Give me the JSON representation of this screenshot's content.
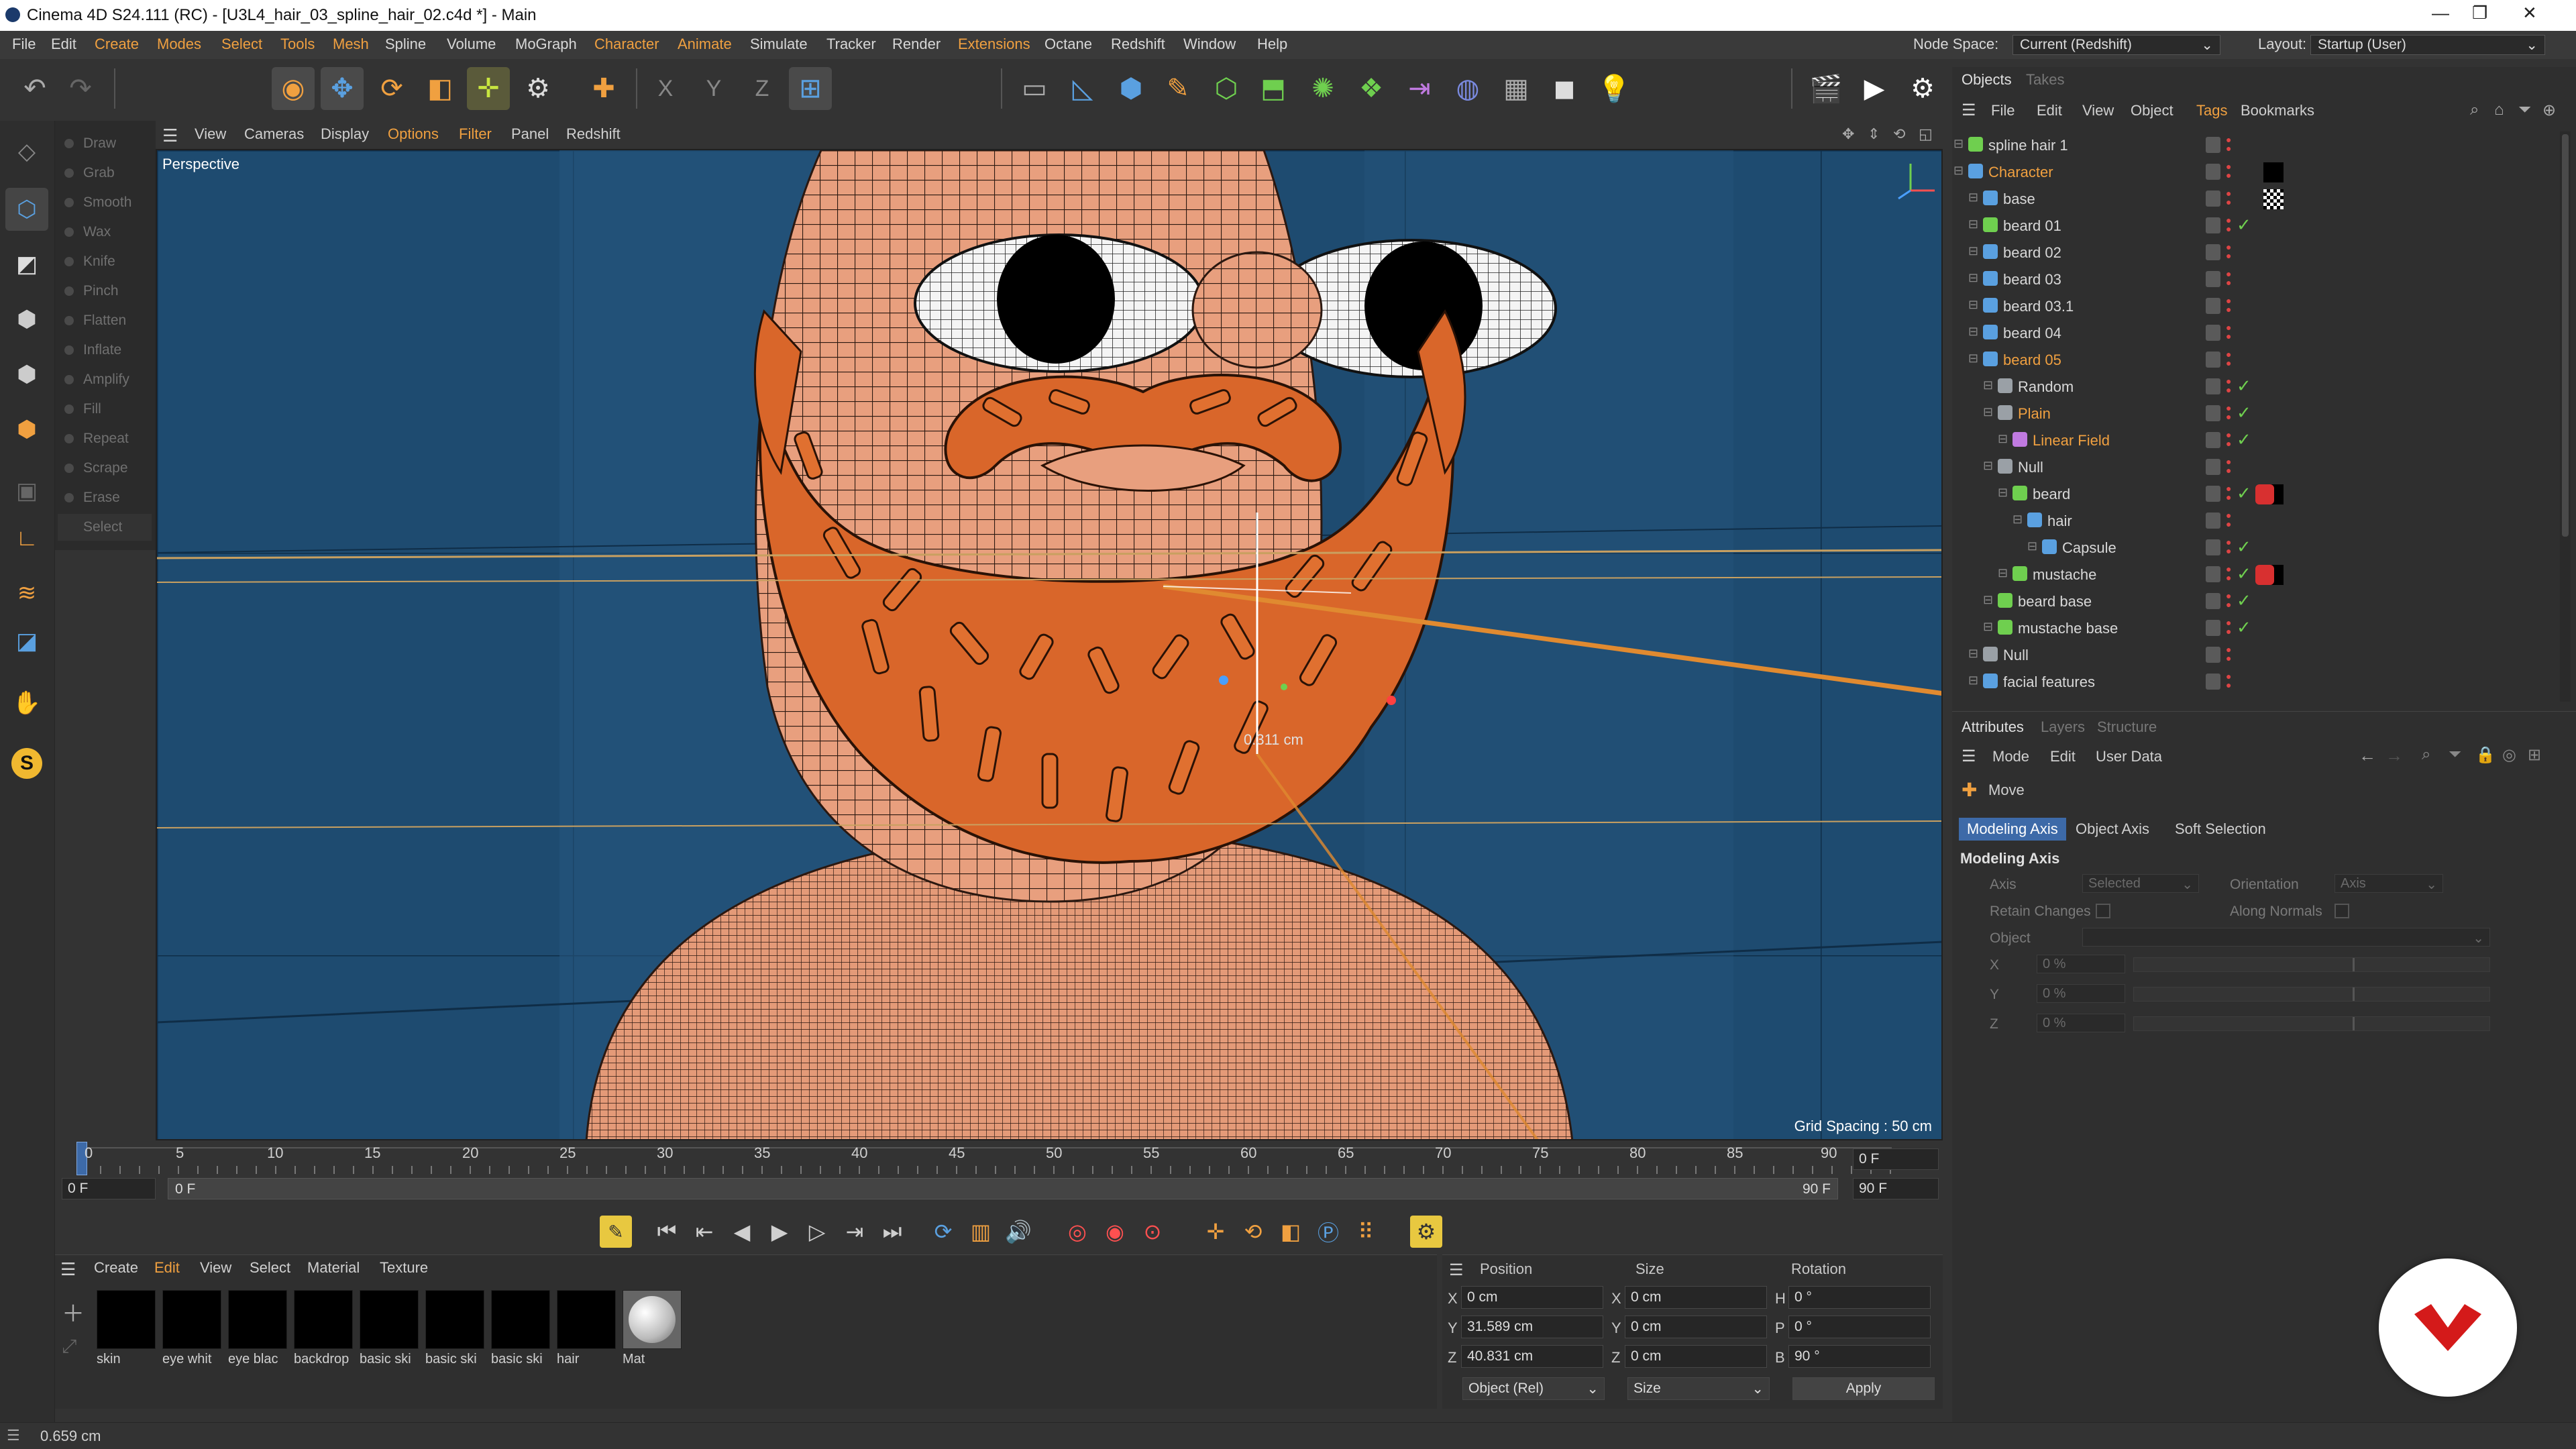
{
  "window": {
    "title": "Cinema 4D S24.111 (RC) - [U3L4_hair_03_spline_hair_02.c4d *] - Main",
    "minimize": "—",
    "maximize": "❐",
    "close": "✕"
  },
  "menu": {
    "items": [
      "File",
      "Edit",
      "Create",
      "Modes",
      "Select",
      "Tools",
      "Mesh",
      "Spline",
      "Volume",
      "MoGraph",
      "Character",
      "Animate",
      "Simulate",
      "Tracker",
      "Render",
      "Extensions",
      "Octane",
      "Redshift",
      "Window",
      "Help"
    ],
    "highlighted": [
      "Create",
      "Modes",
      "Select",
      "Tools",
      "Mesh",
      "Character",
      "Animate",
      "Extensions"
    ],
    "node_space_label": "Node Space:",
    "node_space_value": "Current (Redshift)",
    "layout_label": "Layout:",
    "layout_value": "Startup (User)"
  },
  "toolbar": {
    "axis_x": "X",
    "axis_y": "Y",
    "axis_z": "Z"
  },
  "sculpt": {
    "items": [
      "Draw",
      "Grab",
      "Smooth",
      "Wax",
      "Knife",
      "Pinch",
      "Flatten",
      "Inflate",
      "Amplify",
      "Fill",
      "Repeat",
      "Scrape",
      "Erase",
      "Select"
    ]
  },
  "viewport": {
    "menu": [
      "View",
      "Cameras",
      "Display",
      "Options",
      "Filter",
      "Panel",
      "Redshift"
    ],
    "menu_highlighted": [
      "Options",
      "Filter"
    ],
    "camera": "Perspective",
    "grid_spacing": "Grid Spacing : 50 cm",
    "measure": "0.311 cm"
  },
  "timeline": {
    "ticks": [
      "0",
      "5",
      "10",
      "15",
      "20",
      "25",
      "30",
      "35",
      "40",
      "45",
      "50",
      "55",
      "60",
      "65",
      "70",
      "75",
      "80",
      "85",
      "90"
    ],
    "current_frame": "0 F",
    "start": "0 F",
    "range_start": "0 F",
    "range_end": "90 F",
    "end": "90 F",
    "max": "90 F"
  },
  "materials": {
    "menu": [
      "Create",
      "Edit",
      "View",
      "Select",
      "Material",
      "Texture"
    ],
    "menu_highlighted": [
      "Edit"
    ],
    "items": [
      "skin",
      "eye whit",
      "eye blac",
      "backdrop",
      "basic ski",
      "basic ski",
      "basic ski",
      "hair",
      "Mat"
    ]
  },
  "coords": {
    "headers": [
      "Position",
      "Size",
      "Rotation"
    ],
    "rows": [
      {
        "axis": "X",
        "pos": "0 cm",
        "size_axis": "X",
        "size": "0 cm",
        "rot_axis": "H",
        "rot": "0 °"
      },
      {
        "axis": "Y",
        "pos": "31.589 cm",
        "size_axis": "Y",
        "size": "0 cm",
        "rot_axis": "P",
        "rot": "0 °"
      },
      {
        "axis": "Z",
        "pos": "40.831 cm",
        "size_axis": "Z",
        "size": "0 cm",
        "rot_axis": "B",
        "rot": "90 °"
      }
    ],
    "mode": "Object (Rel)",
    "size_mode": "Size",
    "apply": "Apply"
  },
  "status": {
    "text": "0.659 cm"
  },
  "objects": {
    "tabs": [
      "Objects",
      "Takes"
    ],
    "menu": [
      "File",
      "Edit",
      "View",
      "Object",
      "Tags",
      "Bookmarks"
    ],
    "menu_highlighted": [
      "Tags"
    ],
    "rows": [
      {
        "name": "spline hair 1",
        "indent": 0,
        "orange": false,
        "icon": "#6fcf4f",
        "check": false
      },
      {
        "name": "Character",
        "indent": 0,
        "orange": true,
        "icon": "#5aa0e0",
        "check": false
      },
      {
        "name": "base",
        "indent": 1,
        "orange": false,
        "icon": "#5aa0e0",
        "check": false
      },
      {
        "name": "beard 01",
        "indent": 1,
        "orange": false,
        "icon": "#6fcf4f",
        "check": true
      },
      {
        "name": "beard 02",
        "indent": 1,
        "orange": false,
        "icon": "#5aa0e0",
        "check": false
      },
      {
        "name": "beard 03",
        "indent": 1,
        "orange": false,
        "icon": "#5aa0e0",
        "check": false
      },
      {
        "name": "beard 03.1",
        "indent": 1,
        "orange": false,
        "icon": "#5aa0e0",
        "check": false
      },
      {
        "name": "beard 04",
        "indent": 1,
        "orange": false,
        "icon": "#5aa0e0",
        "check": false
      },
      {
        "name": "beard 05",
        "indent": 1,
        "orange": true,
        "icon": "#5aa0e0",
        "check": false
      },
      {
        "name": "Random",
        "indent": 2,
        "orange": false,
        "icon": "#9aa0a6",
        "check": true
      },
      {
        "name": "Plain",
        "indent": 2,
        "orange": true,
        "icon": "#9aa0a6",
        "check": true
      },
      {
        "name": "Linear Field",
        "indent": 3,
        "orange": true,
        "icon": "#c07ae0",
        "check": true
      },
      {
        "name": "Null",
        "indent": 2,
        "orange": false,
        "icon": "#9aa0a6",
        "check": false
      },
      {
        "name": "beard",
        "indent": 3,
        "orange": false,
        "icon": "#6fcf4f",
        "check": true
      },
      {
        "name": "hair",
        "indent": 4,
        "orange": false,
        "icon": "#5aa0e0",
        "check": false
      },
      {
        "name": "Capsule",
        "indent": 5,
        "orange": false,
        "icon": "#5aa0e0",
        "check": true
      },
      {
        "name": "mustache",
        "indent": 3,
        "orange": false,
        "icon": "#6fcf4f",
        "check": true
      },
      {
        "name": "beard base",
        "indent": 2,
        "orange": false,
        "icon": "#6fcf4f",
        "check": true
      },
      {
        "name": "mustache base",
        "indent": 2,
        "orange": false,
        "icon": "#6fcf4f",
        "check": true
      },
      {
        "name": "Null",
        "indent": 1,
        "orange": false,
        "icon": "#9aa0a6",
        "check": false
      },
      {
        "name": "facial features",
        "indent": 1,
        "orange": false,
        "icon": "#5aa0e0",
        "check": false
      }
    ]
  },
  "attributes": {
    "tabs": [
      "Attributes",
      "Layers",
      "Structure"
    ],
    "menu": [
      "Mode",
      "Edit",
      "User Data"
    ],
    "tool": "Move",
    "subtabs": [
      "Modeling Axis",
      "Object Axis",
      "Soft Selection"
    ],
    "section": "Modeling Axis",
    "axis_label": "Axis",
    "axis_value": "Selected",
    "orientation_label": "Orientation",
    "orientation_value": "Axis",
    "retain_label": "Retain Changes",
    "normals_label": "Along Normals",
    "object_label": "Object",
    "xyz": [
      {
        "axis": "X",
        "value": "0 %"
      },
      {
        "axis": "Y",
        "value": "0 %"
      },
      {
        "axis": "Z",
        "value": "0 %"
      }
    ]
  },
  "colors": {
    "accent_orange": "#f0a040",
    "selection_blue": "#3d6aa8",
    "viewport_bg": "#1e4b70",
    "skin": "#e89f7e",
    "beard": "#d9662a"
  }
}
